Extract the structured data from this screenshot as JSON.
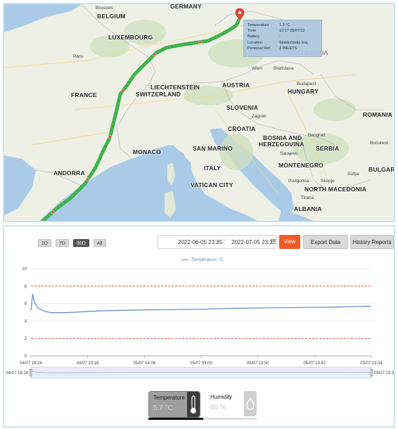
{
  "map": {
    "countries": [
      {
        "id": "germany",
        "label": "GERMANY"
      },
      {
        "id": "belgium",
        "label": "BELGIUM"
      },
      {
        "id": "luxembourg",
        "label": "LUXEMBOURG"
      },
      {
        "id": "france",
        "label": "FRANCE"
      },
      {
        "id": "liechtenstein",
        "label": "LIECHTENSTEIN"
      },
      {
        "id": "switzerland",
        "label": "SWITZERLAND"
      },
      {
        "id": "austria",
        "label": "AUSTRIA"
      },
      {
        "id": "hungary",
        "label": "HUNGARY"
      },
      {
        "id": "slovenia",
        "label": "SLOVENIA"
      },
      {
        "id": "croatia",
        "label": "CROATIA"
      },
      {
        "id": "romania",
        "label": "ROMANIA"
      },
      {
        "id": "bosnia",
        "label": "BOSNIA AND"
      },
      {
        "id": "bosnia2",
        "label": "HERZEGOVINA"
      },
      {
        "id": "serbia",
        "label": "SERBIA"
      },
      {
        "id": "monaco",
        "label": "MONACO"
      },
      {
        "id": "sanmarino",
        "label": "SAN MARINO"
      },
      {
        "id": "italy",
        "label": "ITALY"
      },
      {
        "id": "vatican",
        "label": "VATICAN CITY"
      },
      {
        "id": "montenegro",
        "label": "MONTENEGRO"
      },
      {
        "id": "bulgaria",
        "label": "BULGARIA"
      },
      {
        "id": "andorra",
        "label": "ANDORRA"
      },
      {
        "id": "northmacedonia",
        "label": "NORTH MACEDONIA"
      },
      {
        "id": "albania",
        "label": "ALBANIA"
      },
      {
        "id": "slovakia",
        "label": "SLOVAKIA"
      }
    ],
    "cities": [
      {
        "id": "brussels",
        "label": "Brussels"
      },
      {
        "id": "paris",
        "label": "Paris"
      },
      {
        "id": "wien",
        "label": "Wien"
      },
      {
        "id": "bratislava",
        "label": "Bratislava"
      },
      {
        "id": "budapest",
        "label": "Budapest"
      },
      {
        "id": "zagreb",
        "label": "Zagreb"
      },
      {
        "id": "beograd",
        "label": "Beograd"
      },
      {
        "id": "bucuresti",
        "label": "Bucurest"
      },
      {
        "id": "sarajevo",
        "label": "Sarajevo"
      },
      {
        "id": "podgorica",
        "label": "Podgorica"
      },
      {
        "id": "skopje",
        "label": "Skopje"
      },
      {
        "id": "sofija",
        "label": "Sofija"
      },
      {
        "id": "tirana",
        "label": "Tirana"
      }
    ],
    "popup": {
      "rows": [
        {
          "key": "Temperature",
          "value": "1.3 °C"
        },
        {
          "key": "Time",
          "value": "12:17 05/07/22"
        },
        {
          "key": "Battery",
          "value": "-"
        },
        {
          "key": "Location",
          "value": "Stredočeský kraj"
        },
        {
          "key": "Personal Ref",
          "value": "3 PALETS"
        }
      ]
    },
    "colors": {
      "route": "#3bb54a",
      "marker": "#e8443a",
      "sea": "#a9cbe8",
      "land": "#eef0e6"
    }
  },
  "controls": {
    "range_buttons": [
      {
        "label": "1D",
        "active": false
      },
      {
        "label": "7D",
        "active": false
      },
      {
        "label": "30D",
        "active": true
      },
      {
        "label": "All",
        "active": false
      }
    ],
    "date_from": "2022-06-05 23:35",
    "date_separator": "~",
    "date_to": "2022-07-05 23:35",
    "view_label": "View",
    "export_label": "Export Data",
    "history_label": "History Reports"
  },
  "chart_data": {
    "type": "line",
    "series": [
      {
        "name": "Temperature °C",
        "color": "#5a86c7",
        "x_frac": [
          0,
          0.005,
          0.01,
          0.02,
          0.04,
          0.06,
          0.1,
          0.15,
          0.2,
          0.3,
          0.4,
          0.5,
          0.6,
          0.7,
          0.8,
          0.9,
          1.0
        ],
        "values": [
          5.2,
          7.1,
          6.2,
          5.5,
          5.1,
          4.95,
          4.95,
          5.05,
          5.15,
          5.25,
          5.3,
          5.35,
          5.45,
          5.5,
          5.55,
          5.6,
          5.7
        ]
      }
    ],
    "x_tick_labels": [
      "04/07 18:24",
      "04/07 23:16",
      "05/07 04:08",
      "05/07 09:00",
      "05/07 13:50",
      "05/07 19:42",
      "05/07 23:34"
    ],
    "y_ticks": [
      0,
      2,
      4,
      6,
      8,
      10
    ],
    "ylim": [
      0,
      10
    ],
    "thresholds": [
      {
        "value": 8,
        "color": "#d9534f"
      },
      {
        "value": 2,
        "color": "#d9534f"
      }
    ],
    "grid": true,
    "legend_position": "top-center",
    "navigator": {
      "start_label": "04/07 18:24",
      "end_label": "05/07 23:3"
    }
  },
  "sensors": [
    {
      "label": "Temperature",
      "value": "5.7 °C",
      "active": true,
      "icon": "thermometer-icon"
    },
    {
      "label": "Humidity",
      "value": "80 %",
      "active": false,
      "icon": "drop-icon"
    }
  ]
}
